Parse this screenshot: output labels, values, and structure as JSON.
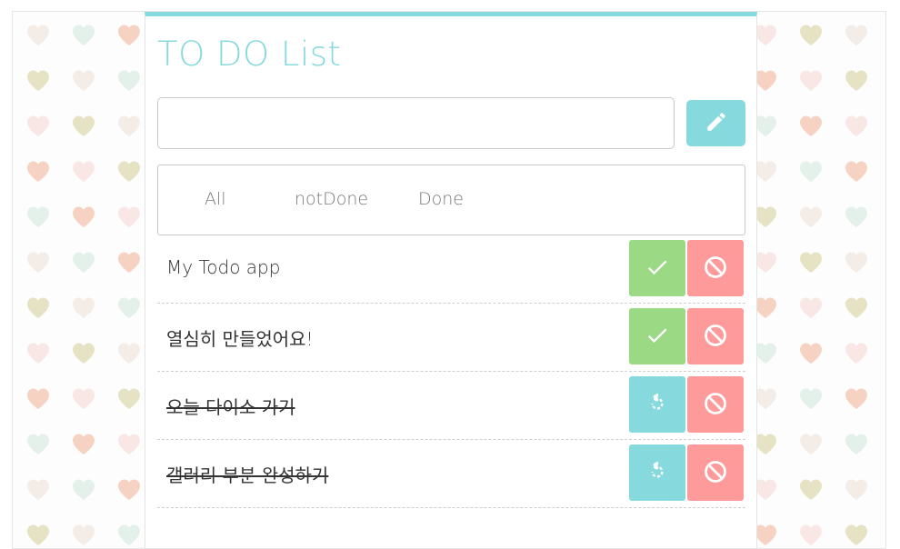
{
  "app": {
    "title": "TO DO List"
  },
  "new_todo": {
    "value": "",
    "placeholder": "",
    "add_icon": "pencil-icon"
  },
  "filters": [
    {
      "label": "All"
    },
    {
      "label": "notDone"
    },
    {
      "label": "Done"
    }
  ],
  "todos": [
    {
      "text": "My Todo app",
      "done": false,
      "toggle_icon": "check-icon",
      "delete_icon": "block-icon"
    },
    {
      "text": "열심히 만들었어요!",
      "done": false,
      "toggle_icon": "check-icon",
      "delete_icon": "block-icon"
    },
    {
      "text": "오늘 다이소 가기",
      "done": true,
      "toggle_icon": "restore-icon",
      "delete_icon": "block-icon"
    },
    {
      "text": "갤러리 부분 완성하기",
      "done": true,
      "toggle_icon": "restore-icon",
      "delete_icon": "block-icon"
    }
  ],
  "colors": {
    "accent": "#86d9dc",
    "done_green": "#9bd985",
    "delete_red": "#fe9a9a",
    "heart_colors": [
      "#f4ece7",
      "#f6d2c2",
      "#e6e2c4",
      "#e3f1ea",
      "#f9e7e5"
    ]
  },
  "background": {
    "pattern_icon": "heart-icon"
  }
}
